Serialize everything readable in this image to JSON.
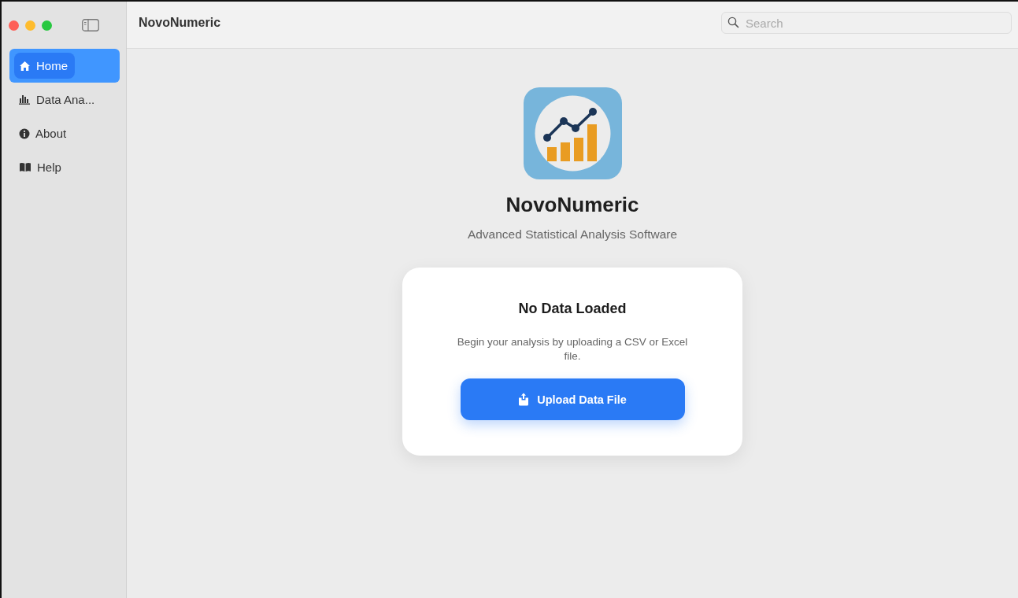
{
  "window": {
    "title": "NovoNumeric"
  },
  "search": {
    "placeholder": "Search"
  },
  "sidebar": {
    "items": [
      {
        "label": "Home",
        "selected": true
      },
      {
        "label": "Data Ana...",
        "selected": false
      },
      {
        "label": "About",
        "selected": false
      },
      {
        "label": "Help",
        "selected": false
      }
    ]
  },
  "hero": {
    "app_name": "NovoNumeric",
    "tagline": "Advanced Statistical Analysis Software"
  },
  "empty_state": {
    "title": "No Data Loaded",
    "message": "Begin your analysis by uploading a CSV or Excel file.",
    "button": "Upload Data File"
  }
}
